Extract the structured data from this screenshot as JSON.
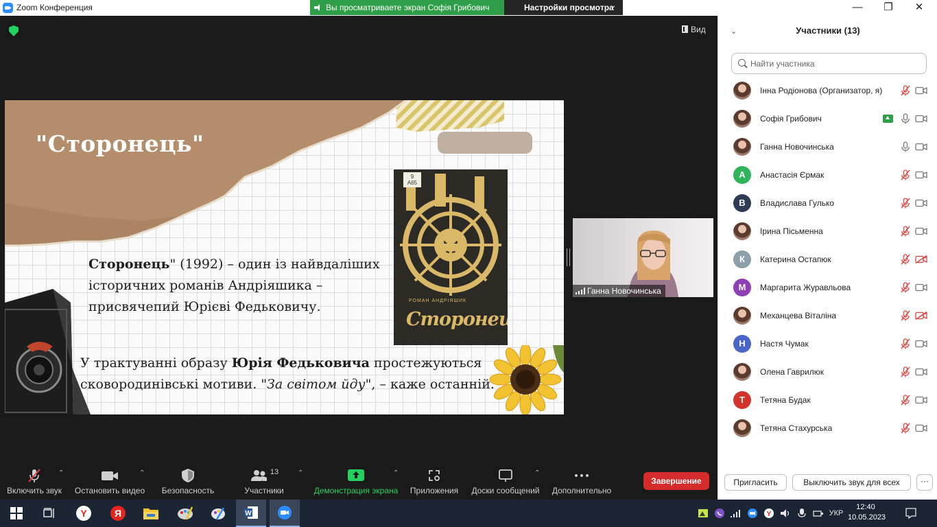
{
  "window": {
    "title": "Zoom Конференция",
    "share_banner": "Вы просматриваете экран Софія Грибович",
    "view_settings": "Настройки просмотра",
    "minimize": "—",
    "maximize": "❐",
    "close": "✕"
  },
  "main": {
    "view_label": "Вид"
  },
  "slide": {
    "title": "\"Сторонець\"",
    "para1_bold": "Сторонець",
    "para1_rest": "\" (1992) – один із найвдаліших історичних романів Андріяшика – присвячепий Юрієві Федьковичу.",
    "para2_part1": "У трактуванні образу ",
    "para2_bold": "Юрія Федьковича",
    "para2_part2": " простежуються сковородинівські мотиви. ",
    "para2_quote": "\"За світом йду\"",
    "para2_part3": ", – каже останній.",
    "book_label": "9\nА65",
    "book_author": "РОМАН АНДРІЯШИК",
    "book_title": "Сторонець"
  },
  "self_video": {
    "name": "Ганна Новочинська"
  },
  "toolbar": {
    "mute": "Включить звук",
    "video": "Остановить видео",
    "security": "Безопасность",
    "participants": "Участники",
    "participants_count": "13",
    "share": "Демонстрация экрана",
    "apps": "Приложения",
    "whiteboards": "Доски сообщений",
    "more": "Дополнительно",
    "end": "Завершение"
  },
  "panel": {
    "title": "Участники (13)",
    "search_placeholder": "Найти участника",
    "invite": "Пригласить",
    "mute_all": "Выключить звук для всех",
    "more": "···",
    "participants": [
      {
        "name": "Інна Родіонова (Организатор, я)",
        "avatar": "photo",
        "color": "",
        "mic": "muted",
        "cam": "on",
        "sharing": false
      },
      {
        "name": "Софія Грибович",
        "avatar": "photo",
        "color": "",
        "mic": "on",
        "cam": "on",
        "sharing": true
      },
      {
        "name": "Ганна Новочинська",
        "avatar": "photo",
        "color": "",
        "mic": "on",
        "cam": "on",
        "sharing": false
      },
      {
        "name": "Анастасія Єрмак",
        "avatar": "А",
        "color": "#2fb45a",
        "mic": "muted",
        "cam": "on",
        "sharing": false
      },
      {
        "name": "Владислава Гулько",
        "avatar": "В",
        "color": "#2e3c55",
        "mic": "muted",
        "cam": "on",
        "sharing": false
      },
      {
        "name": "Ірина Пісьменна",
        "avatar": "photo",
        "color": "",
        "mic": "muted",
        "cam": "on",
        "sharing": false
      },
      {
        "name": "Катерина Остапюк",
        "avatar": "К",
        "color": "#8ca0aa",
        "mic": "muted",
        "cam": "off",
        "sharing": false
      },
      {
        "name": "Маргарита Журавльова",
        "avatar": "М",
        "color": "#8e3fb5",
        "mic": "muted",
        "cam": "on",
        "sharing": false
      },
      {
        "name": "Механцева Віталіна",
        "avatar": "photo",
        "color": "",
        "mic": "muted",
        "cam": "off",
        "sharing": false
      },
      {
        "name": "Настя Чумак",
        "avatar": "Н",
        "color": "#4a64c8",
        "mic": "muted",
        "cam": "on",
        "sharing": false
      },
      {
        "name": "Олена Гаврилюк",
        "avatar": "photo",
        "color": "",
        "mic": "muted",
        "cam": "on",
        "sharing": false
      },
      {
        "name": "Тетяна Будак",
        "avatar": "Т",
        "color": "#d0342c",
        "mic": "muted",
        "cam": "on",
        "sharing": false
      },
      {
        "name": "Тетяна Стахурська",
        "avatar": "photo",
        "color": "",
        "mic": "muted",
        "cam": "on",
        "sharing": false
      }
    ]
  },
  "taskbar": {
    "language": "УКР",
    "time": "12:40",
    "date": "10.05.2023"
  },
  "colors": {
    "zoom_blue": "#2d8cff",
    "share_green": "#2e9f48",
    "end_red": "#d62b2b",
    "muted_red": "#e0443e"
  }
}
